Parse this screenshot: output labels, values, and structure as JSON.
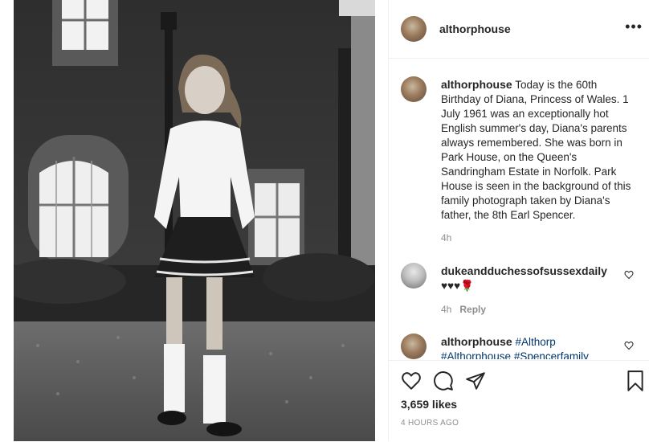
{
  "post": {
    "author": "althorphouse",
    "photo_alt": "Black and white photograph of a young girl in front of a house"
  },
  "caption": {
    "username": "althorphouse",
    "text": "Today is the 60th Birthday of Diana, Princess of Wales. 1 July 1961 was an exceptionally hot English summer's day, Diana's parents always remembered. She was born in Park House, on the Queen's Sandringham Estate in Norfolk. Park House is seen in the background of this family photograph taken by Diana's father, the 8th Earl Spencer.",
    "time": "4h"
  },
  "comments": [
    {
      "username": "dukeandduchessofsussexdaily",
      "text": "♥♥♥🌹",
      "time": "4h",
      "reply_label": "Reply"
    },
    {
      "username": "althorphouse",
      "text_parts": [
        "#Althorp",
        "#Althorphouse",
        "#Spencerfamily"
      ]
    }
  ],
  "stats": {
    "likes": "3,659 likes",
    "posted": "4 HOURS AGO"
  },
  "icons": {
    "more": "more-options-icon",
    "like": "heart-icon",
    "comment": "comment-icon",
    "share": "share-icon",
    "save": "bookmark-icon"
  }
}
